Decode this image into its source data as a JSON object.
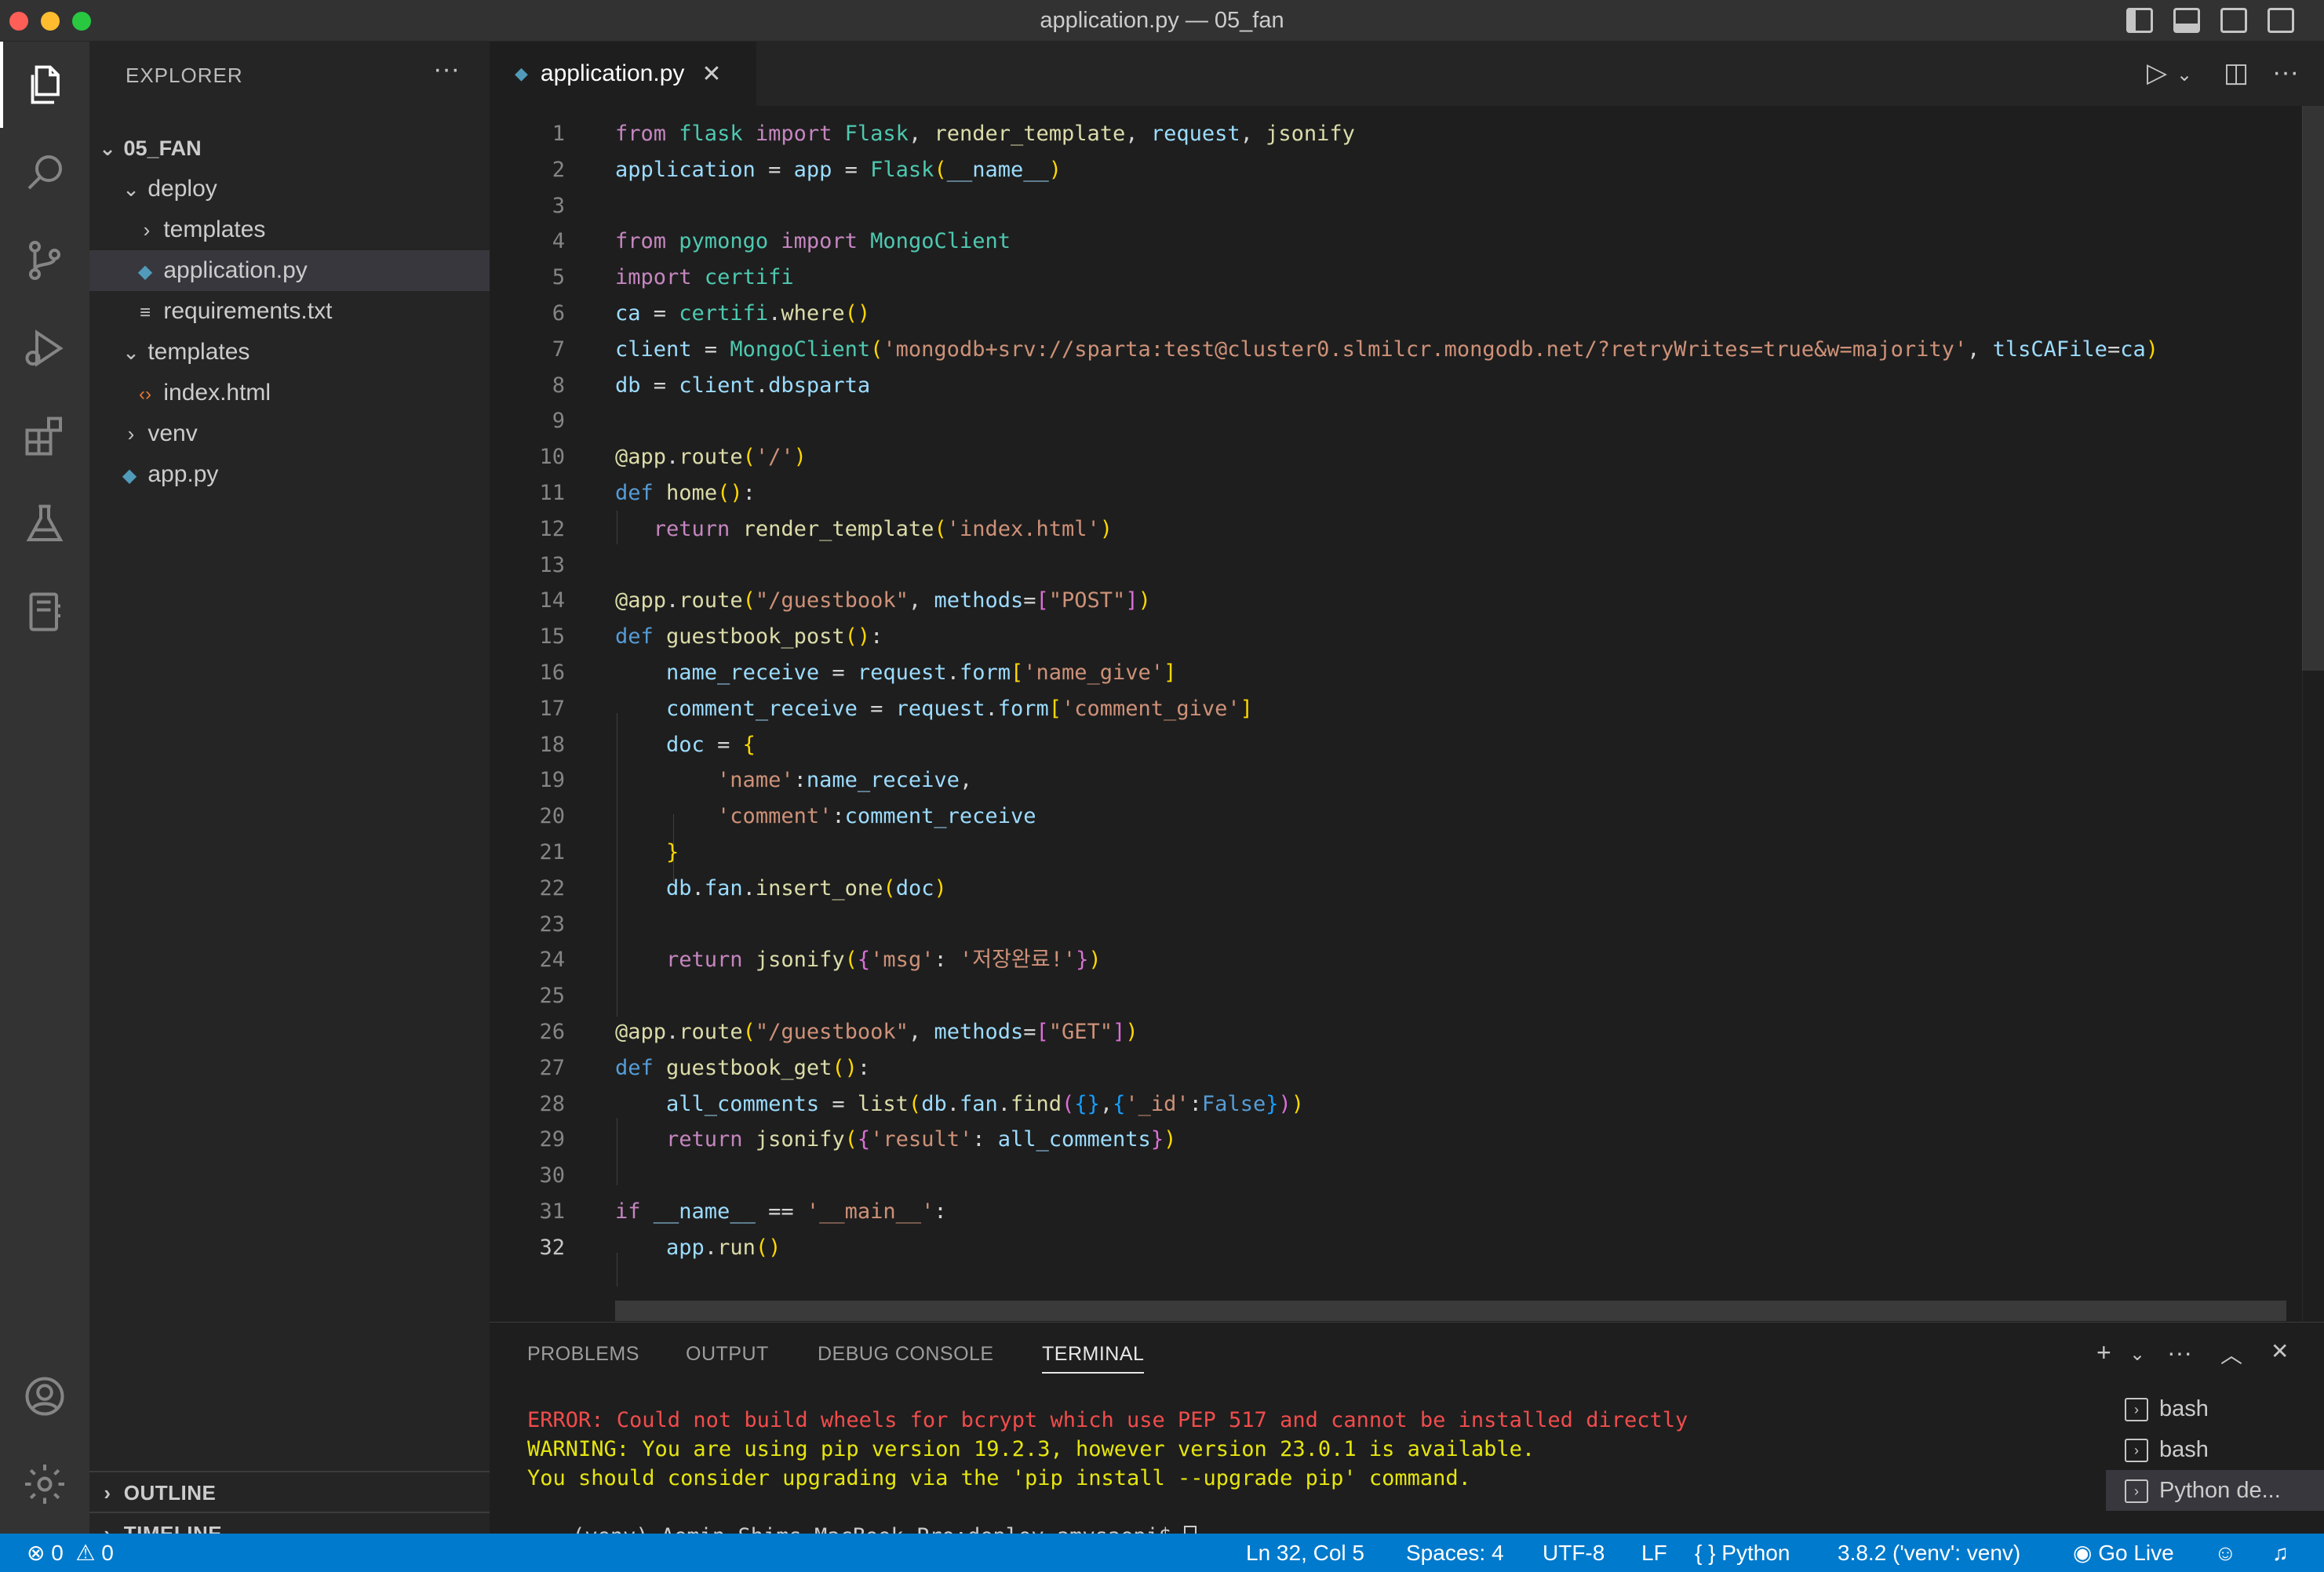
{
  "window": {
    "title": "application.py — 05_fan"
  },
  "sidebar": {
    "header": "EXPLORER",
    "more": "···",
    "tree": [
      {
        "label": "05_FAN",
        "chevron": "v",
        "depth": 0,
        "bold": true
      },
      {
        "label": "deploy",
        "chevron": "v",
        "depth": 1
      },
      {
        "label": "templates",
        "chevron": ">",
        "depth": 2
      },
      {
        "label": "application.py",
        "icon": "python-icon",
        "depth": 2,
        "selected": true
      },
      {
        "label": "requirements.txt",
        "icon": "text-file-icon",
        "depth": 2
      },
      {
        "label": "templates",
        "chevron": "v",
        "depth": 1
      },
      {
        "label": "index.html",
        "icon": "html-icon",
        "depth": 2
      },
      {
        "label": "venv",
        "chevron": ">",
        "depth": 1
      },
      {
        "label": "app.py",
        "icon": "python-icon",
        "depth": 1
      }
    ],
    "outline": "OUTLINE",
    "timeline": "TIMELINE"
  },
  "editor": {
    "tab_label": "application.py",
    "line_numbers": [
      "1",
      "2",
      "3",
      "4",
      "5",
      "6",
      "7",
      "8",
      "9",
      "10",
      "11",
      "12",
      "13",
      "14",
      "15",
      "16",
      "17",
      "18",
      "19",
      "20",
      "21",
      "22",
      "23",
      "24",
      "25",
      "26",
      "27",
      "28",
      "29",
      "30",
      "31",
      "32"
    ],
    "lines": [
      "from flask import Flask, render_template, request, jsonify",
      "application = app = Flask(__name__)",
      "",
      "from pymongo import MongoClient",
      "import certifi",
      "ca = certifi.where()",
      "client = MongoClient('mongodb+srv://sparta:test@cluster0.slmilcr.mongodb.net/?retryWrites=true&w=majority', tlsCAFile=ca)",
      "db = client.dbsparta",
      "",
      "@app.route('/')",
      "def home():",
      "   return render_template('index.html')",
      "",
      "@app.route(\"/guestbook\", methods=[\"POST\"])",
      "def guestbook_post():",
      "    name_receive = request.form['name_give']",
      "    comment_receive = request.form['comment_give']",
      "    doc = {",
      "        'name':name_receive,",
      "        'comment':comment_receive",
      "    }",
      "    db.fan.insert_one(doc)",
      "",
      "    return jsonify({'msg': '저장완료!'})",
      "",
      "@app.route(\"/guestbook\", methods=[\"GET\"])",
      "def guestbook_get():",
      "    all_comments = list(db.fan.find({},{'_id':False}))",
      "    return jsonify({'result': all_comments})",
      "",
      "if __name__ == '__main__':",
      "    app.run()"
    ]
  },
  "panel": {
    "tabs": [
      "PROBLEMS",
      "OUTPUT",
      "DEBUG CONSOLE",
      "TERMINAL"
    ],
    "terminal_lines": [
      "ERROR: Could not build wheels for bcrypt which use PEP 517 and cannot be installed directly",
      "WARNING: You are using pip version 19.2.3, however version 23.0.1 is available.",
      "You should consider upgrading via the 'pip install --upgrade pip' command.",
      "(venv) Aemin-Shims-MacBook-Pro:deploy amysaepi$ "
    ],
    "terminals": [
      "bash",
      "bash",
      "Python de..."
    ]
  },
  "statusbar": {
    "errors": "0",
    "warnings": "0",
    "position": "Ln 32, Col 5",
    "spaces": "Spaces: 4",
    "encoding": "UTF-8",
    "eol": "LF",
    "language": "Python",
    "interpreter": "3.8.2 ('venv': venv)",
    "golive": "Go Live"
  },
  "colors": {
    "statusbar": "#007acc",
    "activitybar": "#333333",
    "sidebar": "#252526",
    "editor": "#1e1e1e"
  }
}
